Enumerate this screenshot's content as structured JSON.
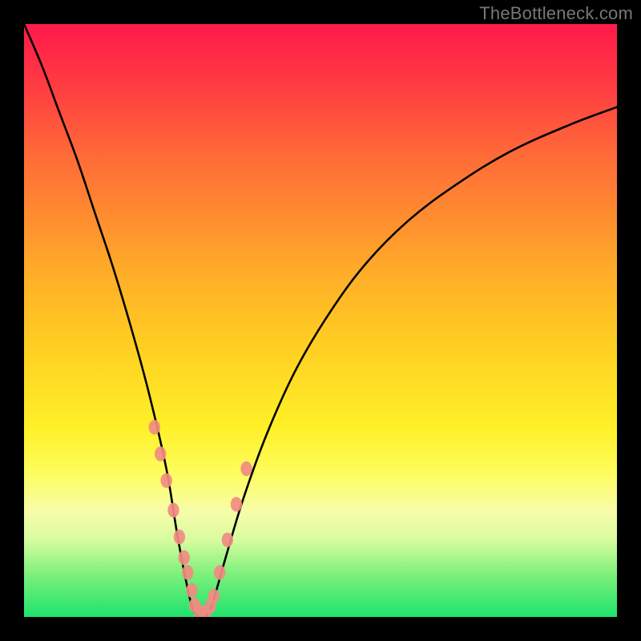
{
  "watermark": "TheBottleneck.com",
  "chart_data": {
    "type": "line",
    "title": "",
    "xlabel": "",
    "ylabel": "",
    "xlim": [
      0,
      100
    ],
    "ylim": [
      0,
      100
    ],
    "grid": false,
    "series": [
      {
        "name": "bottleneck-curve",
        "x": [
          0,
          3,
          6,
          9,
          12,
          15,
          18,
          21,
          24,
          26,
          28,
          29,
          30,
          31,
          32,
          34,
          37,
          41,
          46,
          52,
          58,
          65,
          73,
          82,
          92,
          100
        ],
        "values": [
          100,
          93,
          85,
          77,
          68,
          59,
          49,
          38,
          25,
          13,
          3,
          0.5,
          0,
          0.5,
          3,
          10,
          20,
          31,
          42,
          52,
          60,
          67,
          73,
          78.5,
          83,
          86
        ]
      }
    ],
    "markers": {
      "name": "sample-dots",
      "color": "#f28b82",
      "x": [
        22.0,
        23.0,
        24.0,
        25.2,
        26.2,
        27.0,
        27.6,
        28.3,
        28.8,
        29.6,
        30.5,
        31.4,
        32.0,
        33.0,
        34.3,
        35.8,
        37.5
      ],
      "values": [
        32.0,
        27.5,
        23.0,
        18.0,
        13.5,
        10.0,
        7.5,
        4.5,
        2.0,
        0.8,
        0.6,
        1.8,
        3.5,
        7.5,
        13.0,
        19.0,
        25.0
      ]
    },
    "background_gradient": {
      "orientation": "vertical",
      "stops": [
        {
          "pos": 0.0,
          "color": "#ff1a4b"
        },
        {
          "pos": 0.32,
          "color": "#ff8b30"
        },
        {
          "pos": 0.68,
          "color": "#fff028"
        },
        {
          "pos": 0.93,
          "color": "#7af07a"
        },
        {
          "pos": 1.0,
          "color": "#1de36e"
        }
      ]
    }
  }
}
